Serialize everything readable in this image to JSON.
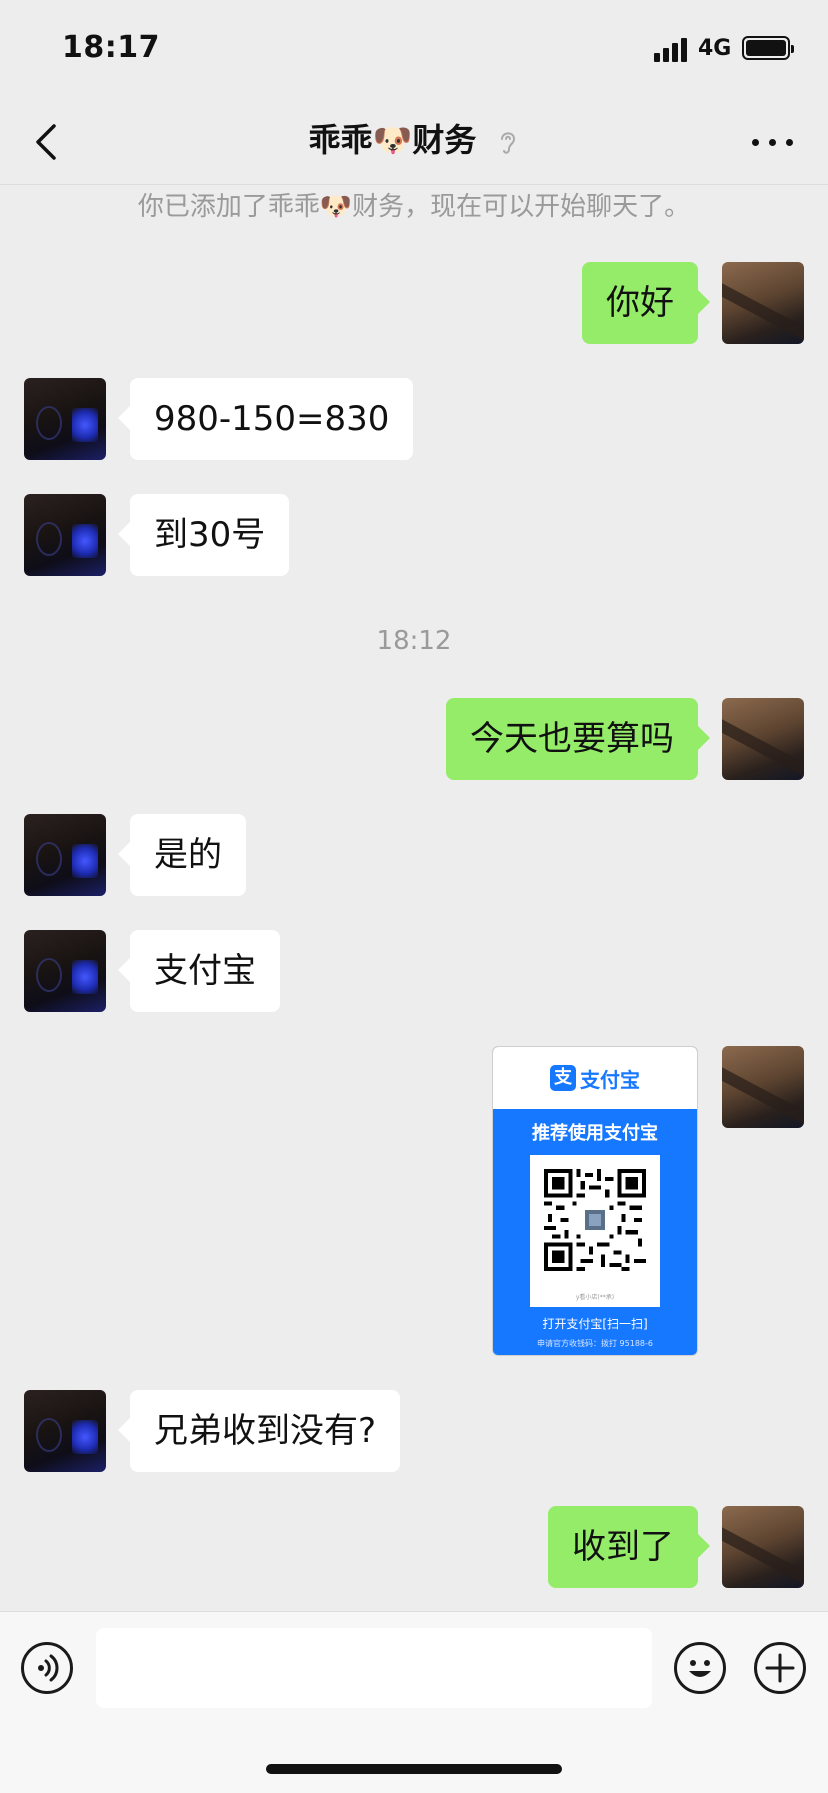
{
  "status_bar": {
    "time": "18:17",
    "network": "4G",
    "icons": [
      "signal-icon",
      "battery-icon"
    ]
  },
  "nav": {
    "title": "乖乖🐶财务",
    "icons": [
      "back-chevron-icon",
      "ear-icon",
      "more-dots-icon"
    ]
  },
  "system_notice": "你已添加了乖乖🐶财务，现在可以开始聊天了。",
  "time_divider": "18:12",
  "messages": [
    {
      "side": "out",
      "text": "你好"
    },
    {
      "side": "in",
      "text": "980-150=830"
    },
    {
      "side": "in",
      "text": "到30号"
    },
    {
      "side": "out",
      "text": "今天也要算吗"
    },
    {
      "side": "in",
      "text": "是的"
    },
    {
      "side": "in",
      "text": "支付宝"
    },
    {
      "side": "in",
      "text": "兄弟收到没有?"
    },
    {
      "side": "out",
      "text": "收到了"
    }
  ],
  "qr_card": {
    "logo_char": "支",
    "brand": "支付宝",
    "slogan": "推荐使用支付宝",
    "qr_caption": "y看小店(**承)",
    "scan_text": "打开支付宝[扫一扫]",
    "hotline": "申请官方收钱码：拨打 95188-6"
  },
  "input_bar": {
    "placeholder": "",
    "icons": [
      "voice-icon",
      "emoji-icon",
      "add-icon"
    ]
  },
  "colors": {
    "background": "#ededed",
    "bubble_out": "#95ec69",
    "bubble_in": "#ffffff",
    "alipay_blue": "#1677ff"
  }
}
